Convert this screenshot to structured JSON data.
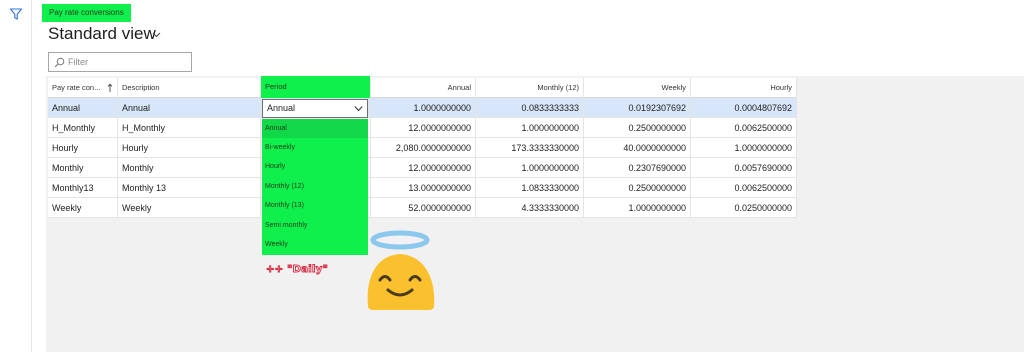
{
  "breadcrumb": {
    "label": "Pay rate conversions"
  },
  "view": {
    "title": "Standard view"
  },
  "filter": {
    "placeholder": "Filter"
  },
  "grid": {
    "columns": [
      "Pay rate con...",
      "Description",
      "Period",
      "Annual",
      "Monthly (12)",
      "Weekly",
      "Hourly"
    ],
    "rows": [
      {
        "code": "Annual",
        "description": "Annual",
        "period": "Annual",
        "annual": "1.0000000000",
        "monthly12": "0.0833333333",
        "weekly": "0.0192307692",
        "hourly": "0.0004807692"
      },
      {
        "code": "H_Monthly",
        "description": "H_Monthly",
        "period": "",
        "annual": "12.0000000000",
        "monthly12": "1.0000000000",
        "weekly": "0.2500000000",
        "hourly": "0.0062500000"
      },
      {
        "code": "Hourly",
        "description": "Hourly",
        "period": "",
        "annual": "2,080.0000000000",
        "monthly12": "173.3333330000",
        "weekly": "40.0000000000",
        "hourly": "1.0000000000"
      },
      {
        "code": "Monthly",
        "description": "Monthly",
        "period": "",
        "annual": "12.0000000000",
        "monthly12": "1.0000000000",
        "weekly": "0.2307690000",
        "hourly": "0.0057690000"
      },
      {
        "code": "Monthly13",
        "description": "Monthly 13",
        "period": "",
        "annual": "13.0000000000",
        "monthly12": "1.0833330000",
        "weekly": "0.2500000000",
        "hourly": "0.0062500000"
      },
      {
        "code": "Weekly",
        "description": "Weekly",
        "period": "",
        "annual": "52.0000000000",
        "monthly12": "4.3333330000",
        "weekly": "1.0000000000",
        "hourly": "0.0250000000"
      }
    ]
  },
  "period_dropdown": {
    "selected": "Annual",
    "options": [
      "Annual",
      "Bi-weekly",
      "Hourly",
      "Monthly (12)",
      "Monthly (13)",
      "Semi monthly",
      "Weekly"
    ]
  },
  "annotation": {
    "text": "++ \"Daily\""
  },
  "icons": {
    "filter": "filter-funnel-icon",
    "title_chevron": "chevron-down-icon",
    "search": "search-icon",
    "sort": "sort-ascending-icon",
    "dropdown": "chevron-down-icon",
    "emoji": "smiling-face-with-halo-emoji"
  },
  "colors": {
    "highlight": "#0ff04c",
    "selected_row": "#d7e6f8",
    "annotation": "#d8263a"
  }
}
